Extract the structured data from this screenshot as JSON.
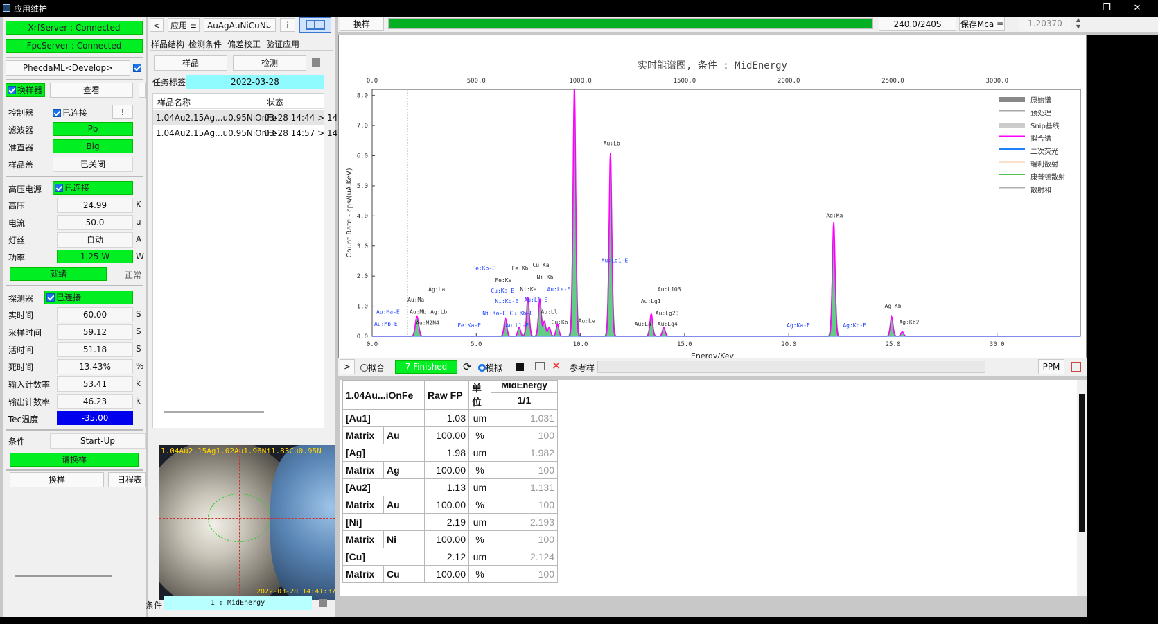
{
  "window": {
    "title": "应用维护"
  },
  "left": {
    "xrf_status": "XrfServer : Connected",
    "fpc_status": "FpcServer : Connected",
    "model": "PhecdaML<Develop>",
    "changer_cb": "换样器",
    "view_btn": "查看",
    "controller": {
      "label": "控制器",
      "status": "已连接",
      "excl": "!"
    },
    "filter": {
      "label": "滤波器",
      "value": "Pb"
    },
    "collimator": {
      "label": "准直器",
      "value": "Big"
    },
    "sample_cover": {
      "label": "样品盖",
      "value": "已关闭"
    },
    "hv": {
      "label": "高压电源",
      "status": "已连接"
    },
    "voltage": {
      "label": "高压",
      "value": "24.99",
      "unit": "K"
    },
    "current": {
      "label": "电流",
      "value": "50.0",
      "unit": "u"
    },
    "filament": {
      "label": "灯丝",
      "value": "自动",
      "unit": "A"
    },
    "power": {
      "label": "功率",
      "value": "1.25 W",
      "unit": "W"
    },
    "ready": "就绪",
    "normal": "正常",
    "detector": {
      "label": "探测器",
      "status": "已连接"
    },
    "metrics": [
      {
        "label": "实时间",
        "value": "60.00",
        "unit": "S"
      },
      {
        "label": "采样时间",
        "value": "59.12",
        "unit": "S"
      },
      {
        "label": "活时间",
        "value": "51.18",
        "unit": "S"
      },
      {
        "label": "死时间",
        "value": "13.43%",
        "unit": "%"
      },
      {
        "label": "输入计数率",
        "value": "53.41",
        "unit": "k"
      },
      {
        "label": "输出计数率",
        "value": "46.23",
        "unit": "k"
      }
    ],
    "tec": {
      "label": "Tec温度",
      "value": "-35.00"
    },
    "condition": {
      "label": "条件",
      "value": "Start-Up"
    },
    "please_change": "请换样",
    "change_btn": "换样",
    "schedule_btn": "日程表"
  },
  "mid": {
    "back": "<",
    "app_menu": "应用 ≡",
    "app_select": "AuAgAuNiCuNi",
    "info": "i",
    "tabs": [
      "样品结构",
      "检测条件",
      "偏差校正",
      "验证应用"
    ],
    "sample_btn": "样品",
    "detect_btn": "检测",
    "task_label": "任务标签",
    "task_date": "2022-03-28",
    "columns": [
      "样品名称",
      "状态"
    ],
    "rows": [
      {
        "name": "1.04Au2.15Ag...u0.95NiOnFe",
        "status": "03-28 14:44 > 14"
      },
      {
        "name": "1.04Au2.15Ag...u0.95NiOnFe",
        "status": "03-28 14:57 > 14"
      }
    ],
    "camera_caption": "1.04Au2.15Ag1.02Au1.96Ni1.83Cu0.95N",
    "camera_time": "2022-03-28 14:41:37",
    "cond_label": "条件",
    "cond_value": "1 : MidEnergy"
  },
  "top": {
    "change_btn": "换样",
    "progress": 1.0,
    "progress_text": "240.0/240S",
    "save_btn": "保存Mca ≡",
    "spin_value": "1.20370"
  },
  "chart_data": {
    "type": "line",
    "title": "实时能谱图, 条件 : MidEnergy",
    "xlabel": "Energy/Kev",
    "ylabel": "Count Rate - cps/(uA.KeV)",
    "xlim": [
      0,
      34
    ],
    "ylim": [
      0,
      8.2
    ],
    "xticks": [
      "0.0",
      "5.0",
      "10.0",
      "15.0",
      "20.0",
      "25.0",
      "30.0"
    ],
    "xticks_top": [
      "0.0",
      "500.0",
      "1000.0",
      "1500.0",
      "2000.0",
      "2500.0",
      "3000.0"
    ],
    "yticks": [
      "0.0",
      "1.0",
      "2.0",
      "3.0",
      "4.0",
      "5.0",
      "6.0",
      "7.0",
      "8.0"
    ],
    "legend": [
      "原始谱",
      "预处理",
      "Snip基线",
      "拟合谱",
      "二次荧光",
      "瑞利散射",
      "康普顿散射",
      "散射和"
    ],
    "legend_colors": [
      "#888888",
      "#aaaaaa",
      "#cccccc",
      "#ff00ff",
      "#2080ff",
      "#f5c090",
      "#50c050",
      "#b0b0b0"
    ],
    "peaks": [
      {
        "x": 2.12,
        "h": 0.45
      },
      {
        "x": 2.2,
        "h": 0.35
      },
      {
        "x": 6.4,
        "h": 0.6
      },
      {
        "x": 7.06,
        "h": 0.3
      },
      {
        "x": 7.48,
        "h": 1.3
      },
      {
        "x": 8.05,
        "h": 1.25
      },
      {
        "x": 8.27,
        "h": 0.5
      },
      {
        "x": 8.5,
        "h": 0.3
      },
      {
        "x": 8.9,
        "h": 0.4
      },
      {
        "x": 9.71,
        "h": 8.3
      },
      {
        "x": 11.44,
        "h": 6.1
      },
      {
        "x": 13.4,
        "h": 0.75
      },
      {
        "x": 14.0,
        "h": 0.3
      },
      {
        "x": 22.16,
        "h": 3.8
      },
      {
        "x": 24.94,
        "h": 0.65
      },
      {
        "x": 25.45,
        "h": 0.15
      }
    ],
    "annotations": [
      {
        "text": "Au:Ma-E",
        "x": 0.2,
        "y": 0.75,
        "c": "#2244ff"
      },
      {
        "text": "Au:Mb-E",
        "x": 0.1,
        "y": 0.35,
        "c": "#2244ff"
      },
      {
        "text": "Au:Ma",
        "x": 1.7,
        "y": 1.15,
        "c": "#333"
      },
      {
        "text": "Au:Mb",
        "x": 1.8,
        "y": 0.75,
        "c": "#333"
      },
      {
        "text": "Au:M2N4",
        "x": 2.1,
        "y": 0.38,
        "c": "#333"
      },
      {
        "text": "Ag:La",
        "x": 2.7,
        "y": 1.5,
        "c": "#333"
      },
      {
        "text": "Ag:Lb",
        "x": 2.8,
        "y": 0.75,
        "c": "#333"
      },
      {
        "text": "Fe:Ka-E",
        "x": 4.1,
        "y": 0.3,
        "c": "#2244ff"
      },
      {
        "text": "Fe:Kb-E",
        "x": 4.8,
        "y": 2.2,
        "c": "#2244ff"
      },
      {
        "text": "Fe:Ka",
        "x": 5.9,
        "y": 1.8,
        "c": "#333"
      },
      {
        "text": "Fe:Kb",
        "x": 6.7,
        "y": 2.2,
        "c": "#333"
      },
      {
        "text": "Cu:Ka",
        "x": 7.7,
        "y": 2.3,
        "c": "#333"
      },
      {
        "text": "Ni:Kb",
        "x": 7.9,
        "y": 1.9,
        "c": "#333"
      },
      {
        "text": "Ni:Ka",
        "x": 7.1,
        "y": 1.5,
        "c": "#333"
      },
      {
        "text": "Cu:Ka-E",
        "x": 5.7,
        "y": 1.45,
        "c": "#2244ff"
      },
      {
        "text": "Ni:Kb-E",
        "x": 5.9,
        "y": 1.1,
        "c": "#2244ff"
      },
      {
        "text": "Au:Le-E",
        "x": 8.4,
        "y": 1.5,
        "c": "#2244ff"
      },
      {
        "text": "Au:Ll-E",
        "x": 7.3,
        "y": 1.15,
        "c": "#2244ff"
      },
      {
        "text": "Ni:Ka-E",
        "x": 5.3,
        "y": 0.7,
        "c": "#2244ff"
      },
      {
        "text": "Cu:Kb-E",
        "x": 6.6,
        "y": 0.7,
        "c": "#2244ff"
      },
      {
        "text": "Au:Ll",
        "x": 8.1,
        "y": 0.75,
        "c": "#333"
      },
      {
        "text": "Cu:Kb",
        "x": 8.6,
        "y": 0.4,
        "c": "#333"
      },
      {
        "text": "Au:Ll-E",
        "x": 6.4,
        "y": 0.3,
        "c": "#2244ff"
      },
      {
        "text": "Au:Le",
        "x": 9.9,
        "y": 0.45,
        "c": "#333"
      },
      {
        "text": "Au:Lb",
        "x": 11.1,
        "y": 6.35,
        "c": "#333"
      },
      {
        "text": "Au:Lg1-E",
        "x": 11.0,
        "y": 2.45,
        "c": "#2244ff"
      },
      {
        "text": "Au:L1O3",
        "x": 13.7,
        "y": 1.5,
        "c": "#333"
      },
      {
        "text": "Au:Lg1",
        "x": 12.9,
        "y": 1.1,
        "c": "#333"
      },
      {
        "text": "Au:Lg23",
        "x": 13.6,
        "y": 0.7,
        "c": "#333"
      },
      {
        "text": "Au:Lg4",
        "x": 13.7,
        "y": 0.35,
        "c": "#333"
      },
      {
        "text": "Au:La",
        "x": 12.6,
        "y": 0.35,
        "c": "#333"
      },
      {
        "text": "Ag:Ka-E",
        "x": 19.9,
        "y": 0.3,
        "c": "#2244ff"
      },
      {
        "text": "Ag:Ka",
        "x": 21.8,
        "y": 3.95,
        "c": "#333"
      },
      {
        "text": "Ag:Kb-E",
        "x": 22.6,
        "y": 0.3,
        "c": "#2244ff"
      },
      {
        "text": "Ag:Kb",
        "x": 24.6,
        "y": 0.95,
        "c": "#333"
      },
      {
        "text": "Ag:Kb2",
        "x": 25.3,
        "y": 0.4,
        "c": "#333"
      }
    ]
  },
  "results_bar": {
    "expand": ">",
    "fit_label": "拟合",
    "finished": "7 Finished",
    "simulate_label": "模拟",
    "ref_label": "参考样",
    "ppm": "PPM"
  },
  "results": {
    "col_name": "1.04Au...iOnFe",
    "col_raw": "Raw FP",
    "col_unit": "单位",
    "col_cond_top": "MidEnergy",
    "col_cond": "1/1",
    "rows": [
      {
        "name": "[Au1]",
        "sub": "",
        "raw": "1.03",
        "unit": "um",
        "val": "1.031"
      },
      {
        "name": "Matrix",
        "sub": "Au",
        "raw": "100.00",
        "unit": "%",
        "val": "100"
      },
      {
        "name": "[Ag]",
        "sub": "",
        "raw": "1.98",
        "unit": "um",
        "val": "1.982"
      },
      {
        "name": "Matrix",
        "sub": "Ag",
        "raw": "100.00",
        "unit": "%",
        "val": "100"
      },
      {
        "name": "[Au2]",
        "sub": "",
        "raw": "1.13",
        "unit": "um",
        "val": "1.131"
      },
      {
        "name": "Matrix",
        "sub": "Au",
        "raw": "100.00",
        "unit": "%",
        "val": "100"
      },
      {
        "name": "[Ni]",
        "sub": "",
        "raw": "2.19",
        "unit": "um",
        "val": "2.193"
      },
      {
        "name": "Matrix",
        "sub": "Ni",
        "raw": "100.00",
        "unit": "%",
        "val": "100"
      },
      {
        "name": "[Cu]",
        "sub": "",
        "raw": "2.12",
        "unit": "um",
        "val": "2.124"
      },
      {
        "name": "Matrix",
        "sub": "Cu",
        "raw": "100.00",
        "unit": "%",
        "val": "100"
      }
    ]
  }
}
